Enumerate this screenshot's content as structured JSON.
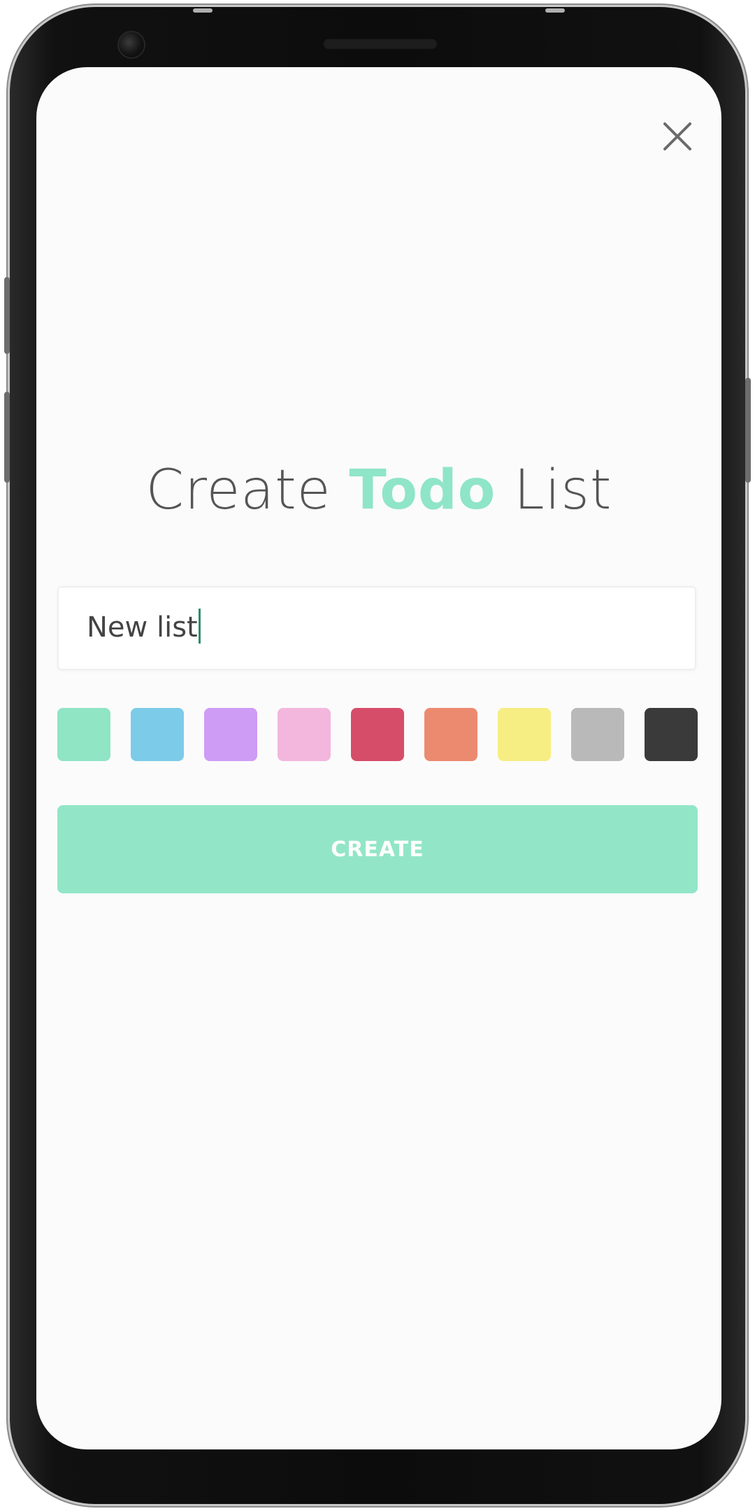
{
  "header": {
    "close_icon": "close-icon"
  },
  "title": {
    "part1": "Create ",
    "accent": "Todo",
    "part2": " List",
    "accent_color": "#8fe5c7"
  },
  "form": {
    "name_value": "New list"
  },
  "colors": [
    {
      "name": "mint",
      "hex": "#8fe5c4"
    },
    {
      "name": "sky-blue",
      "hex": "#7ccbe9"
    },
    {
      "name": "lavender",
      "hex": "#ce9bf5"
    },
    {
      "name": "pink",
      "hex": "#f3b6dc"
    },
    {
      "name": "crimson",
      "hex": "#d64d6a"
    },
    {
      "name": "salmon",
      "hex": "#ec8a70"
    },
    {
      "name": "yellow",
      "hex": "#f6ee83"
    },
    {
      "name": "gray",
      "hex": "#b9b9b9"
    },
    {
      "name": "charcoal",
      "hex": "#3a3a3a"
    }
  ],
  "actions": {
    "create_label": "CREATE",
    "create_color": "#92e6c7"
  }
}
